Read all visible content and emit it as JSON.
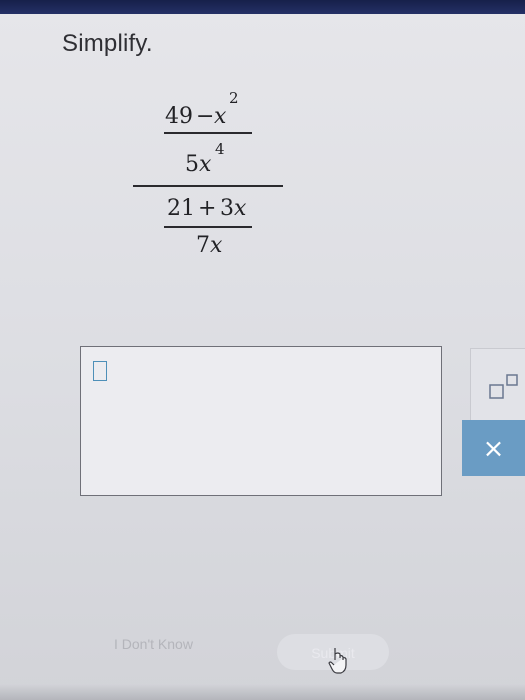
{
  "prompt": "Simplify.",
  "expression": {
    "top_numerator": {
      "constant": "49",
      "op": "−",
      "var": "x",
      "exp": "2"
    },
    "top_denominator": {
      "coef": "5",
      "var": "x",
      "exp": "4"
    },
    "bottom_numerator": {
      "constant": "21",
      "op": "+",
      "term": "3",
      "var": "x"
    },
    "bottom_denominator": {
      "coef": "7",
      "var": "x"
    }
  },
  "answer_input": {
    "value": ""
  },
  "buttons": {
    "clear_label": "×",
    "dont_know_label": "I Don't Know",
    "submit_label": "Submit"
  },
  "icons": {
    "template": "fraction-template-icon",
    "cursor": "hand-pointer-icon"
  },
  "colors": {
    "accent": "#6a9cc4",
    "header": "#1d2756",
    "slot": "#4e8fb8"
  }
}
